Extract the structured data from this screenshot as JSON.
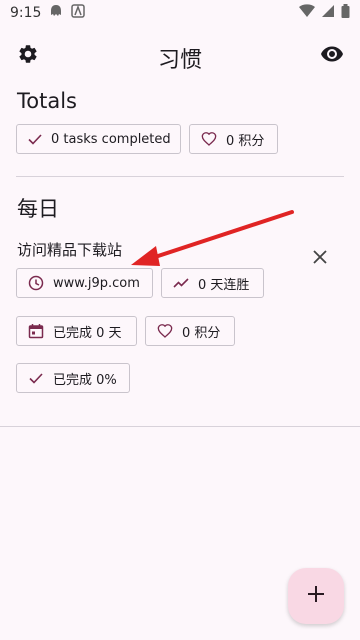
{
  "status_bar": {
    "time": "9:15"
  },
  "app_bar": {
    "title": "习惯"
  },
  "totals": {
    "title": "Totals",
    "tasks_completed": "0 tasks completed",
    "points": "0 积分"
  },
  "daily": {
    "title": "每日",
    "habit": {
      "name": "访问精品下载站",
      "reminder": "www.j9p.com",
      "streak": "0 天连胜",
      "completed_days": "已完成 0 天",
      "points": "0 积分",
      "completed_percent": "已完成 0%"
    }
  },
  "colors": {
    "accent": "#7a2a4e",
    "fab_bg": "#f9d8e4",
    "annotation_arrow": "#e02424"
  },
  "icons": [
    "gear-icon",
    "eye-icon",
    "check-icon",
    "heart-icon",
    "clock-icon",
    "trend-icon",
    "calendar-icon",
    "close-icon",
    "plus-icon"
  ]
}
